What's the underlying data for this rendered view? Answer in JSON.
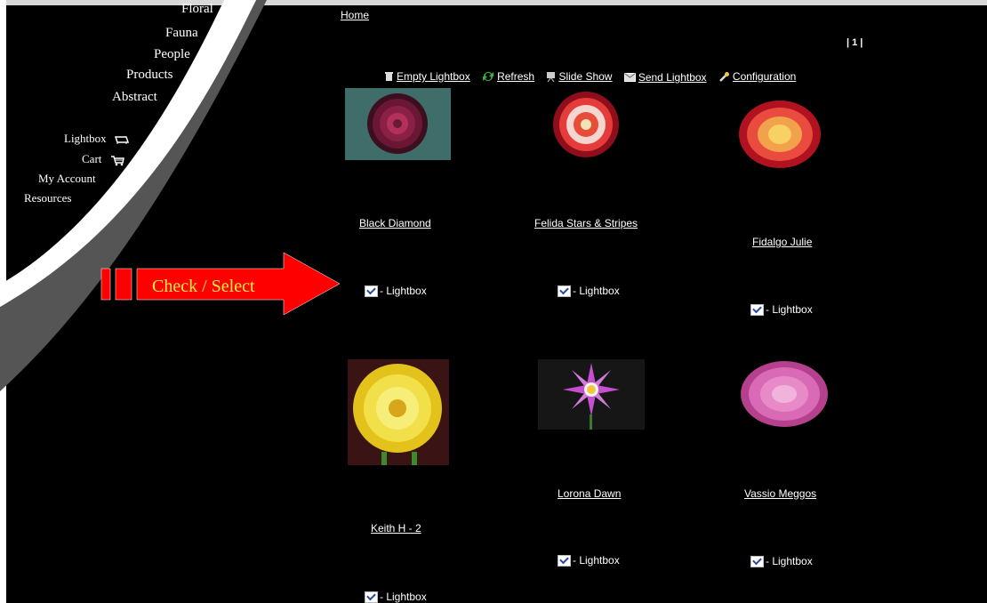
{
  "nav": {
    "floral": "Floral",
    "fauna": "Fauna",
    "people": "People",
    "products": "Products",
    "abstract": "Abstract",
    "lightbox": "Lightbox",
    "cart": "Cart",
    "my_account": "My Account",
    "resources": "Resources"
  },
  "breadcrumb": "Home",
  "pager": "| 1 |",
  "toolbar": {
    "empty": "Empty Lightbox",
    "refresh": "Refresh",
    "slideshow": "Slide Show",
    "send": "Send Lightbox",
    "config": "Configuration"
  },
  "items": [
    {
      "caption": "Black Diamond",
      "lightbox": "- Lightbox"
    },
    {
      "caption": "Felida Stars & Stripes",
      "lightbox": "- Lightbox"
    },
    {
      "caption": "Fidalgo Julie",
      "lightbox": "- Lightbox"
    },
    {
      "caption": "Keith H - 2",
      "lightbox": "- Lightbox"
    },
    {
      "caption": "Lorona Dawn",
      "lightbox": "- Lightbox"
    },
    {
      "caption": "Vassio Meggos",
      "lightbox": "- Lightbox"
    }
  ],
  "annotation": {
    "label": "Check / Select",
    "color": "#ff0000",
    "text_color": "#ffef3a"
  }
}
